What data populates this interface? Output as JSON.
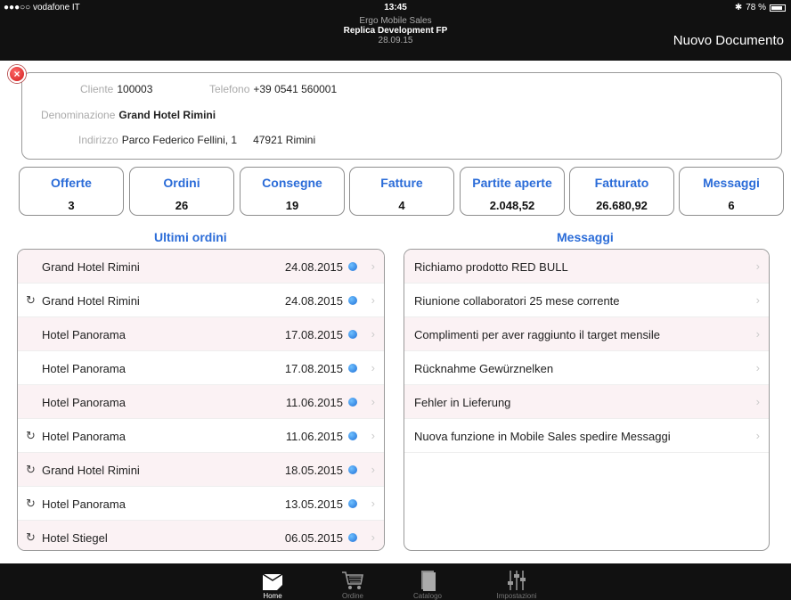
{
  "status": {
    "carrier": "●●●○○ vodafone IT",
    "time": "13:45",
    "battery": "78 %"
  },
  "header": {
    "app_name": "Ergo Mobile Sales",
    "project": "Replica Development FP",
    "date": "28.09.15",
    "new_document": "Nuovo Documento"
  },
  "client": {
    "cliente_label": "Cliente",
    "cliente_value": "100003",
    "telefono_label": "Telefono",
    "telefono_value": "+39 0541 560001",
    "denominazione_label": "Denominazione",
    "denominazione_value": "Grand Hotel Rimini",
    "indirizzo_label": "Indirizzo",
    "indirizzo_value": "Parco Federico Fellini, 1",
    "cap_city": "47921 Rimini"
  },
  "stats": [
    {
      "title": "Offerte",
      "value": "3"
    },
    {
      "title": "Ordini",
      "value": "26"
    },
    {
      "title": "Consegne",
      "value": "19"
    },
    {
      "title": "Fatture",
      "value": "4"
    },
    {
      "title": "Partite aperte",
      "value": "2.048,52"
    },
    {
      "title": "Fatturato",
      "value": "26.680,92"
    },
    {
      "title": "Messaggi",
      "value": "6"
    }
  ],
  "orders": {
    "title": "Ultimi ordini",
    "rows": [
      {
        "sync": false,
        "name": "Grand Hotel Rimini",
        "date": "24.08.2015"
      },
      {
        "sync": true,
        "name": "Grand Hotel Rimini",
        "date": "24.08.2015"
      },
      {
        "sync": false,
        "name": "Hotel Panorama",
        "date": "17.08.2015"
      },
      {
        "sync": false,
        "name": "Hotel Panorama",
        "date": "17.08.2015"
      },
      {
        "sync": false,
        "name": "Hotel Panorama",
        "date": "11.06.2015"
      },
      {
        "sync": true,
        "name": "Hotel Panorama",
        "date": "11.06.2015"
      },
      {
        "sync": true,
        "name": "Grand Hotel Rimini",
        "date": "18.05.2015"
      },
      {
        "sync": true,
        "name": "Hotel Panorama",
        "date": "13.05.2015"
      },
      {
        "sync": true,
        "name": "Hotel Stiegel",
        "date": "06.05.2015"
      }
    ]
  },
  "messages": {
    "title": "Messaggi",
    "rows": [
      "Richiamo prodotto RED BULL",
      "Riunione collaboratori 25 mese corrente",
      "Complimenti per aver raggiunto il target mensile",
      "Rücknahme Gewürznelken",
      "Fehler in Lieferung",
      "Nuova funzione in Mobile Sales spedire Messaggi"
    ]
  },
  "tabs": [
    {
      "label": "Home",
      "icon": "home-icon",
      "active": true
    },
    {
      "label": "Ordine",
      "icon": "cart-icon",
      "active": false
    },
    {
      "label": "Catalogo",
      "icon": "catalog-icon",
      "active": false
    },
    {
      "label": "Impostazioni",
      "icon": "settings-icon",
      "active": false
    }
  ]
}
